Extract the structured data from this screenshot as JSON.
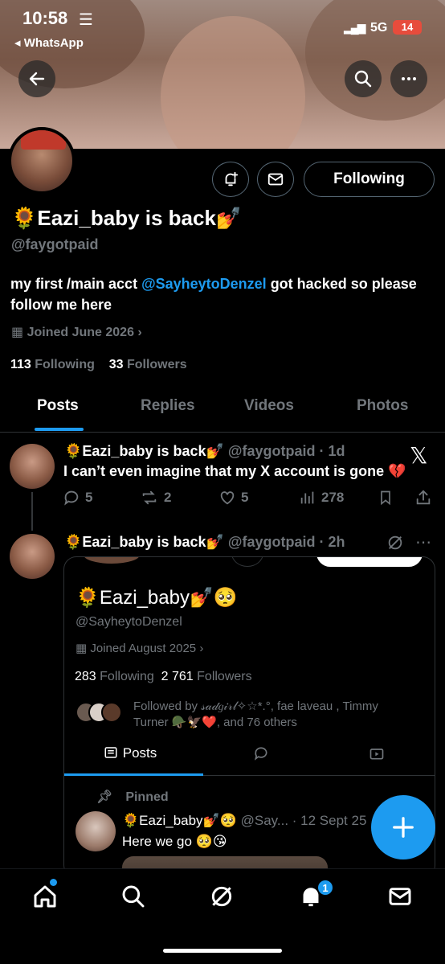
{
  "status_bar": {
    "time": "10:58",
    "back_app": "◂ WhatsApp",
    "network": "5G",
    "battery": "14"
  },
  "profile": {
    "name": "🌻Eazi_baby is back💅",
    "handle": "@faygotpaid",
    "bio_before": "my first /main acct ",
    "bio_mention": "@SayheytoDenzel",
    "bio_after": " got hacked so please follow me here",
    "joined": "Joined June 2026",
    "following_count": "113",
    "following_label": "Following",
    "followers_count": "33",
    "followers_label": "Followers",
    "follow_button": "Following"
  },
  "tabs": [
    "Posts",
    "Replies",
    "Videos",
    "Photos"
  ],
  "post1": {
    "name": "🌻Eazi_baby is back💅",
    "handle_time": "@faygotpaid · 1d",
    "text": "I can’t even imagine that my X account is gone 💔",
    "replies": "5",
    "reposts": "2",
    "likes": "5",
    "views": "278"
  },
  "post2": {
    "name": "🌻Eazi_baby is back💅",
    "handle_time": "@faygotpaid · 2h"
  },
  "card": {
    "name": "🌻Eazi_baby💅🥺",
    "handle": "@SayheytoDenzel",
    "joined": "Joined August 2025",
    "following_count": "283",
    "following_label": "Following",
    "followers_count": "2 761",
    "followers_label": "Followers",
    "followed_by": "Followed by 𝓈𝒶𝒹𝑔𝒾𝓇𝓁✧☆*.°, fae laveau , Timmy Turner 🪖🦅❤️, and 76 others",
    "tab_posts": "Posts",
    "pinned": "Pinned",
    "pin_name": "🌻Eazi_baby💅🥺",
    "pin_meta": " @Say... · 12 Sept 25",
    "pin_text": "Here we go 🥺😘"
  },
  "notifications_badge": "1",
  "icons": [
    "back-arrow-icon",
    "search-icon",
    "more-icon",
    "notification-add-icon",
    "mail-icon",
    "calendar-icon",
    "reply-icon",
    "repost-icon",
    "like-icon",
    "views-icon",
    "bookmark-icon",
    "share-icon",
    "grok-icon",
    "pin-icon",
    "home-icon",
    "bell-icon"
  ]
}
